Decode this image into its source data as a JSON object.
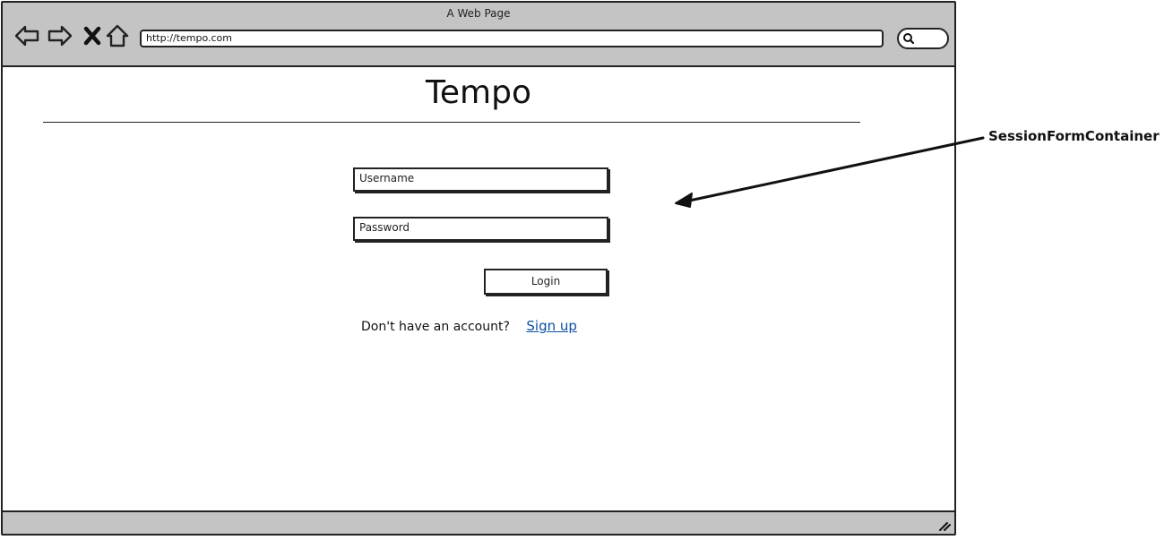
{
  "window": {
    "title": "A Web Page",
    "url": "http://tempo.com"
  },
  "icons": {
    "back": "back-arrow-icon",
    "forward": "forward-arrow-icon",
    "stop": "close-icon",
    "home": "home-icon",
    "search": "search-icon",
    "resize": "resize-grip-icon"
  },
  "page": {
    "title": "Tempo"
  },
  "form": {
    "username_placeholder": "Username",
    "password_placeholder": "Password",
    "login_label": "Login",
    "signup_prompt": "Don't have an account?",
    "signup_link": "Sign up"
  },
  "annotation": {
    "label": "SessionFormContainer"
  },
  "colors": {
    "chrome": "#c4c4c4",
    "link": "#0b4fa3",
    "stroke": "#222222"
  }
}
